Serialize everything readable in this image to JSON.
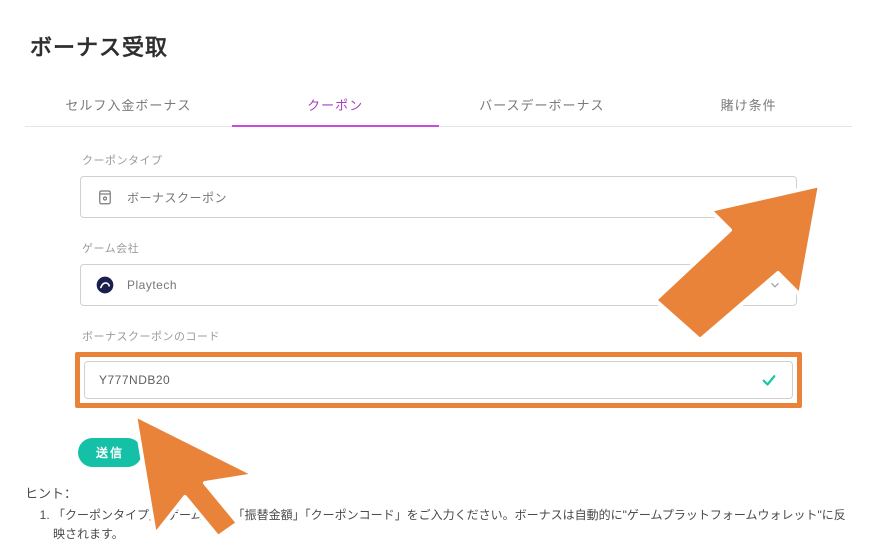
{
  "page": {
    "title": "ボーナス受取"
  },
  "tabs": [
    {
      "label": "セルフ入金ボーナス",
      "active": false
    },
    {
      "label": "クーポン",
      "active": true
    },
    {
      "label": "バースデーボーナス",
      "active": false
    },
    {
      "label": "賭け条件",
      "active": false
    }
  ],
  "form": {
    "coupon_type": {
      "label": "クーポンタイプ",
      "value": "ボーナスクーポン"
    },
    "game_company": {
      "label": "ゲーム会社",
      "value": "Playtech"
    },
    "bonus_code": {
      "label": "ボーナスクーポンのコード",
      "value": "Y777NDB20"
    },
    "submit_label": "送信"
  },
  "hints": {
    "title": "ヒント：",
    "items": [
      "「クーポンタイプ」「ゲーム会社」「振替金額」「クーポンコード」をご入力ください。ボーナスは自動的に\"ゲームプラットフォームウォレット\"に反映されます。"
    ]
  },
  "annotation": {
    "arrow_color": "#e98339"
  }
}
